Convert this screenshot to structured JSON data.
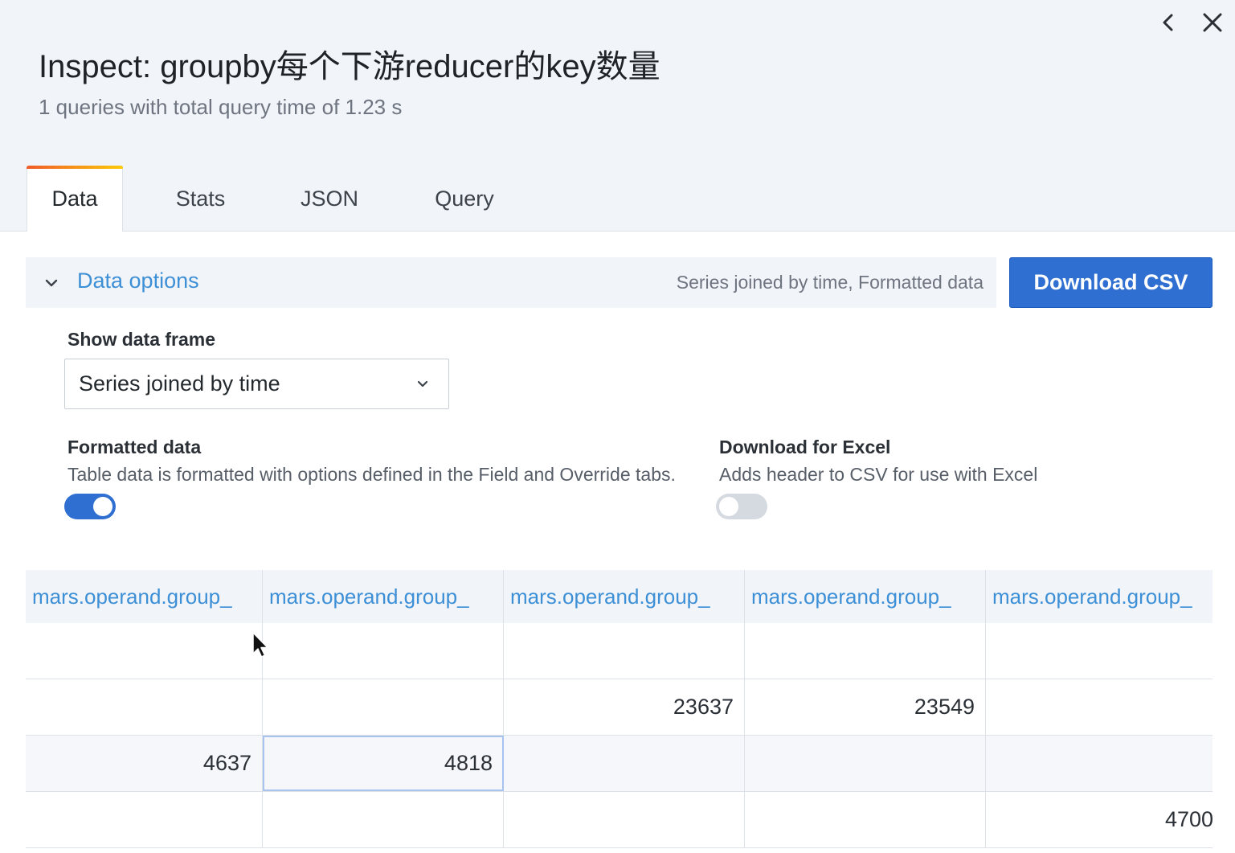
{
  "header": {
    "title": "Inspect: groupby每个下游reducer的key数量",
    "subtitle": "1 queries with total query time of 1.23 s",
    "back_icon": "chevron-left-icon",
    "close_icon": "close-icon"
  },
  "tabs": [
    {
      "label": "Data",
      "active": true
    },
    {
      "label": "Stats",
      "active": false
    },
    {
      "label": "JSON",
      "active": false
    },
    {
      "label": "Query",
      "active": false
    }
  ],
  "options": {
    "title": "Data options",
    "summary": "Series joined by time, Formatted data",
    "expanded": true
  },
  "download_button": "Download CSV",
  "data_frame": {
    "label": "Show data frame",
    "value": "Series joined by time"
  },
  "formatted": {
    "label": "Formatted data",
    "description": "Table data is formatted with options defined in the Field and Override tabs.",
    "enabled": true
  },
  "excel": {
    "label": "Download for Excel",
    "description": "Adds header to CSV for use with Excel",
    "enabled": false
  },
  "table": {
    "headers": [
      "mars.operand.group_",
      "mars.operand.group_",
      "mars.operand.group_",
      "mars.operand.group_",
      "mars.operand.group_"
    ],
    "rows": [
      [
        "",
        "",
        "",
        "",
        ""
      ],
      [
        "",
        "",
        "23637",
        "23549",
        ""
      ],
      [
        "4637",
        "4818",
        "",
        "",
        ""
      ],
      [
        "",
        "",
        "",
        "",
        "4700"
      ]
    ]
  },
  "colors": {
    "accent_blue": "#3d8fd6",
    "primary_button": "#2f6fd1",
    "header_bg": "#f1f4f9",
    "tab_gradient_start": "#f05a28",
    "tab_gradient_end": "#fbca0a"
  }
}
